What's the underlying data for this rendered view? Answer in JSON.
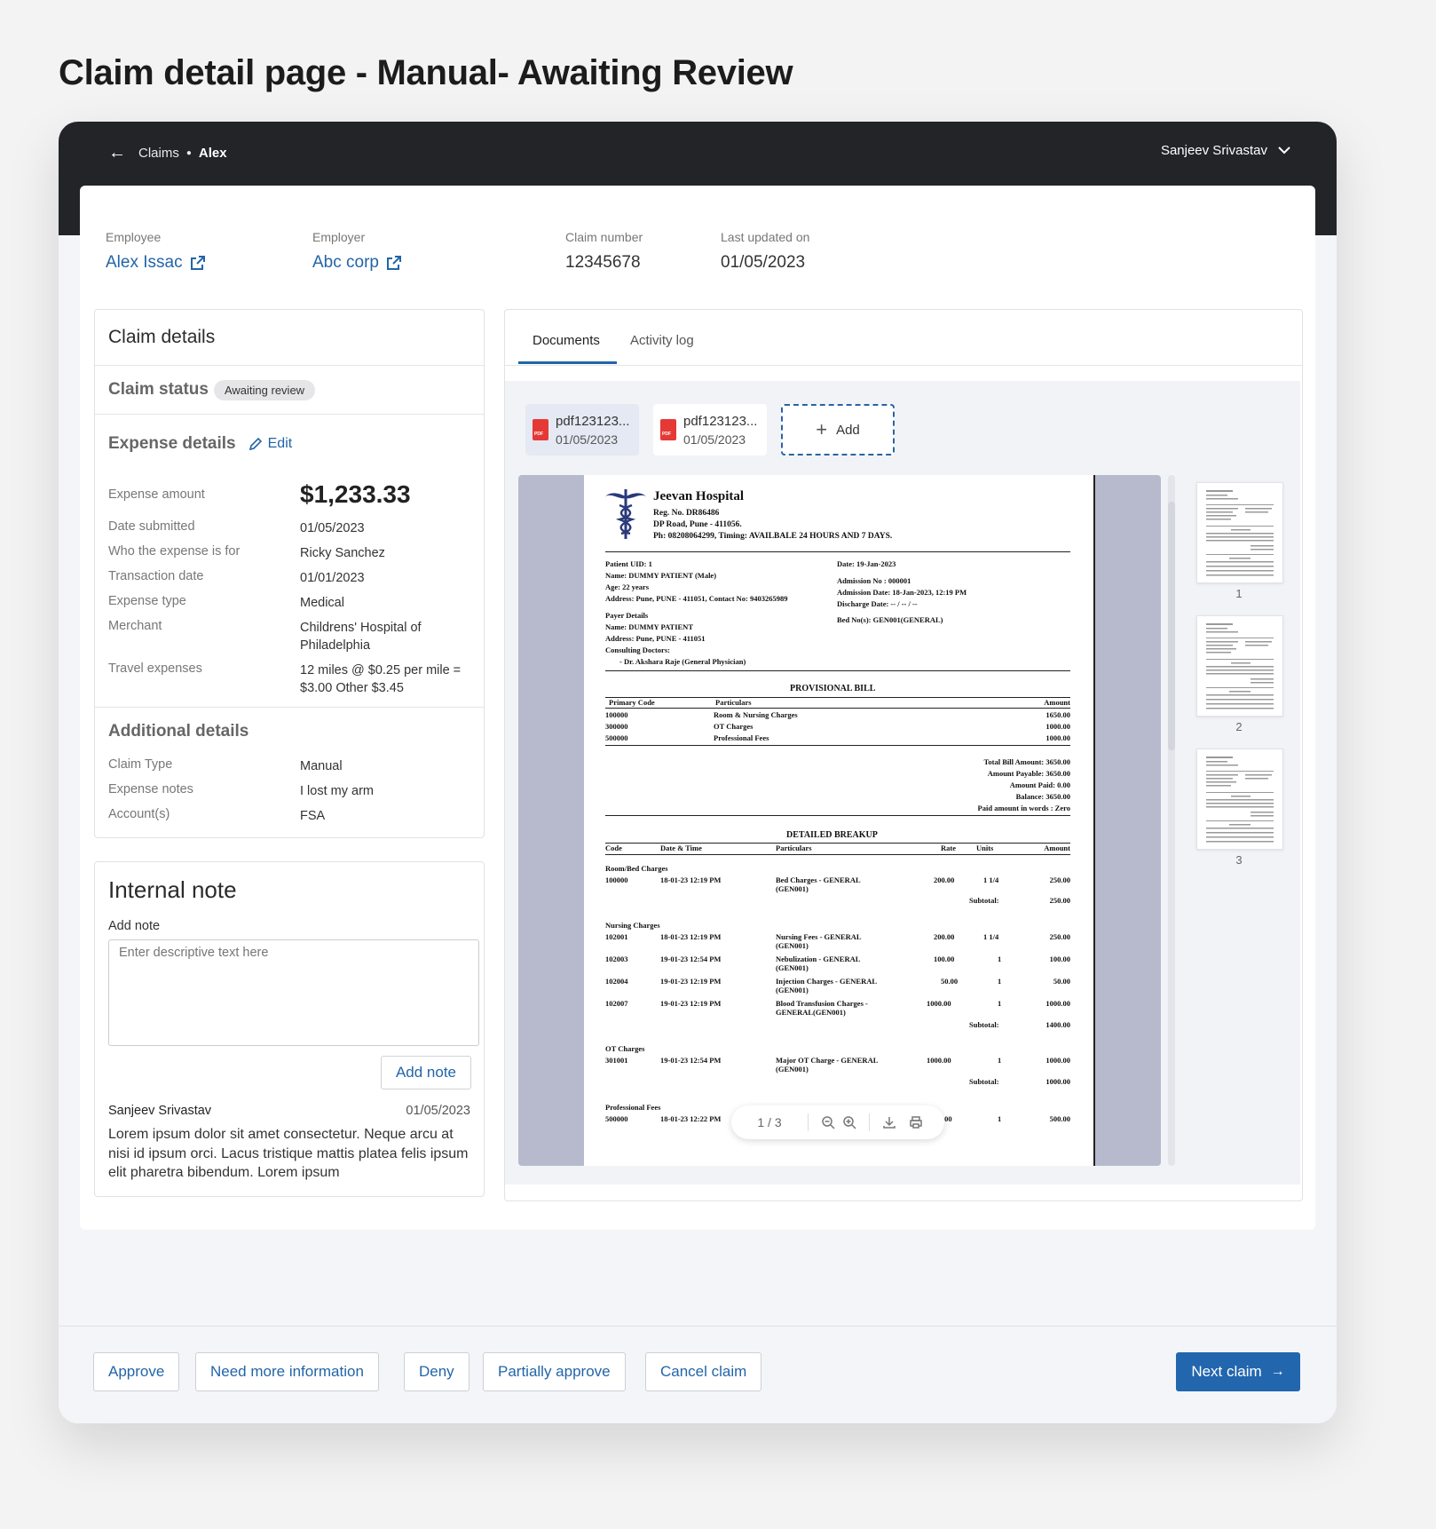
{
  "page_title": "Claim detail page - Manual- Awaiting Review",
  "header": {
    "breadcrumb_root": "Claims",
    "breadcrumb_current": "Alex",
    "user_name": "Sanjeev Srivastav"
  },
  "summary": {
    "employee_label": "Employee",
    "employee_value": "Alex Issac",
    "employer_label": "Employer",
    "employer_value": "Abc corp",
    "claim_number_label": "Claim number",
    "claim_number_value": "12345678",
    "last_updated_label": "Last updated on",
    "last_updated_value": "01/05/2023"
  },
  "claim_details": {
    "title": "Claim details",
    "status_label": "Claim status",
    "status_badge": "Awaiting review",
    "expense_title": "Expense details",
    "edit_label": "Edit",
    "expense_rows": [
      {
        "k": "Expense amount",
        "v": "$1,233.33"
      },
      {
        "k": "Date submitted",
        "v": "01/05/2023"
      },
      {
        "k": "Who the expense is for",
        "v": "Ricky Sanchez"
      },
      {
        "k": "Transaction date",
        "v": "01/01/2023"
      },
      {
        "k": "Expense type",
        "v": "Medical"
      },
      {
        "k": "Merchant",
        "v": "Childrens' Hospital of Philadelphia"
      },
      {
        "k": "Travel expenses",
        "v": "12 miles @ $0.25 per mile = $3.00 Other $3.45"
      }
    ],
    "additional_title": "Additional details",
    "additional_rows": [
      {
        "k": "Claim Type",
        "v": "Manual"
      },
      {
        "k": "Expense notes",
        "v": "I lost my arm"
      },
      {
        "k": "Account(s)",
        "v": "FSA"
      }
    ]
  },
  "internal_note": {
    "title": "Internal note",
    "add_label": "Add note",
    "placeholder": "Enter descriptive text here",
    "button": "Add note",
    "author": "Sanjeev Srivastav",
    "date": "01/05/2023",
    "text": "Lorem ipsum dolor sit amet consectetur. Neque arcu at nisi id ipsum orci. Lacus tristique mattis platea felis ipsum elit pharetra bibendum. Lorem ipsum"
  },
  "documents": {
    "tabs": [
      "Documents",
      "Activity log"
    ],
    "files": [
      {
        "name": "pdf123123...",
        "date": "01/05/2023"
      },
      {
        "name": "pdf123123...",
        "date": "01/05/2023"
      }
    ],
    "add_label": "Add",
    "page_indicator": "1 / 3",
    "thumb_numbers": [
      "1",
      "2",
      "3"
    ]
  },
  "bill": {
    "hospital": "Jeevan Hospital",
    "reg": "Reg. No. DR86486",
    "address": "DP Road, Pune - 411056.",
    "phone": "Ph: 08208064299, Timing: AVAILBALE 24 HOURS AND 7 DAYS.",
    "patient_uid": "Patient UID: 1",
    "patient_name": "Name: DUMMY PATIENT  (Male)",
    "patient_age": "Age: 22 years",
    "patient_address": "Address: Pune, PUNE - 411051, Contact No: 9403265989",
    "payer_title": "Payer Details",
    "payer_name": "Name: DUMMY PATIENT",
    "payer_address": "Address: Pune, PUNE - 411051",
    "consulting_title": "Consulting Doctors:",
    "consulting_doc": "- Dr. Akshara Raje (General Physician)",
    "date": "Date: 19-Jan-2023",
    "admission_no": "Admission No     : 000001",
    "admission_date": "Admission Date: 18-Jan-2023, 12:19 PM",
    "discharge_date": "Discharge Date: -- / -- / --",
    "bed_no": "Bed No(s): GEN001(GENERAL)",
    "provisional_title": "PROVISIONAL BILL",
    "prov_headers": [
      "Primary Code",
      "Particulars",
      "Amount"
    ],
    "prov_rows": [
      [
        "100000",
        "Room & Nursing Charges",
        "1650.00"
      ],
      [
        "300000",
        "OT Charges",
        "1000.00"
      ],
      [
        "500000",
        "Professional Fees",
        "1000.00"
      ]
    ],
    "totals": [
      "Total Bill Amount: 3650.00",
      "Amount Payable: 3650.00",
      "Amount Paid: 0.00",
      "Balance: 3650.00",
      "Paid amount in words : Zero"
    ],
    "breakup_title": "DETAILED BREAKUP",
    "breakup_headers": [
      "Code",
      "Date & Time",
      "Particulars",
      "Rate",
      "Units",
      "Amount"
    ],
    "group_room": "Room/Bed Charges",
    "row_room": [
      "100000",
      "18-01-23 12:19 PM",
      "Bed Charges - GENERAL",
      "(GEN001)",
      "200.00",
      "1 1/4",
      "250.00"
    ],
    "subtotal_label": "Subtotal:",
    "subtotal_room": "250.00",
    "group_nursing": "Nursing Charges",
    "rows_nursing": [
      [
        "102001",
        "18-01-23 12:19 PM",
        "Nursing Fees - GENERAL",
        "(GEN001)",
        "200.00",
        "1 1/4",
        "250.00"
      ],
      [
        "102003",
        "19-01-23 12:54 PM",
        "Nebulization - GENERAL",
        "(GEN001)",
        "100.00",
        "1",
        "100.00"
      ],
      [
        "102004",
        "19-01-23 12:19 PM",
        "Injection Charges - GENERAL",
        "(GEN001)",
        "50.00",
        "1",
        "50.00"
      ],
      [
        "102007",
        "19-01-23 12:19 PM",
        "Blood Transfusion Charges -",
        "GENERAL(GEN001)",
        "1000.00",
        "1",
        "1000.00"
      ]
    ],
    "subtotal_nursing": "1400.00",
    "group_ot": "OT Charges",
    "row_ot": [
      "301001",
      "19-01-23 12:54 PM",
      "Major OT Charge - GENERAL",
      "(GEN001)",
      "1000.00",
      "1",
      "1000.00"
    ],
    "subtotal_ot": "1000.00",
    "group_prof": "Professional Fees",
    "row_prof": [
      "500000",
      "18-01-23 12:22 PM",
      "",
      "",
      ".00",
      "1",
      "500.00"
    ]
  },
  "footer": {
    "approve": "Approve",
    "more_info": "Need more information",
    "deny": "Deny",
    "partial": "Partially approve",
    "cancel": "Cancel claim",
    "next": "Next claim"
  }
}
